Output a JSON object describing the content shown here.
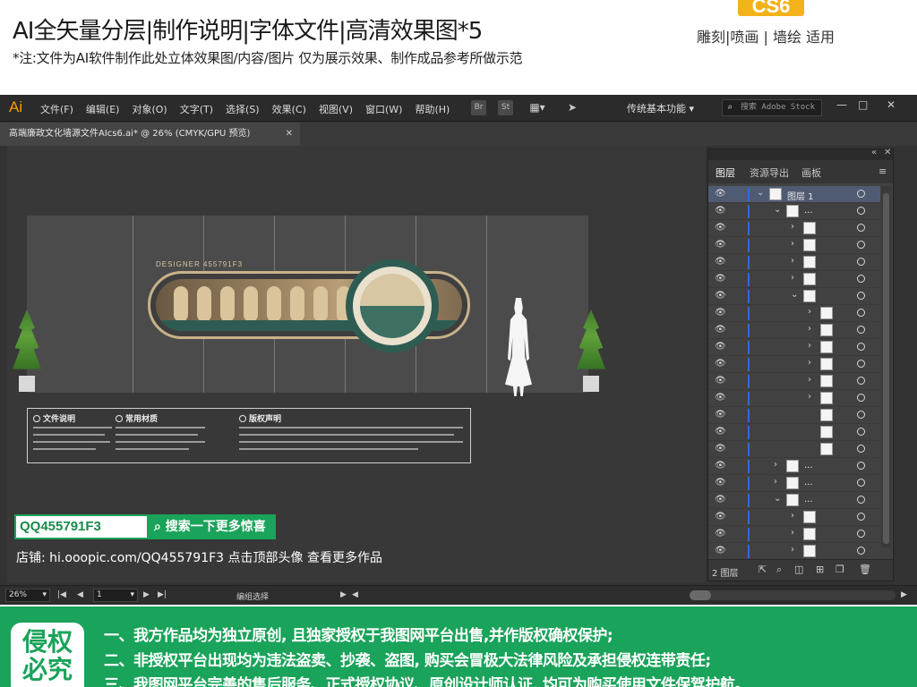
{
  "promo": {
    "title": "AI全矢量分层|制作说明|字体文件|高清效果图*5",
    "note": "*注:文件为AI软件制作此处立体效果图/内容/图片 仅为展示效果、制作成品参考所做示范",
    "version_badge": "CS6",
    "usage": "雕刻|喷画 | 墙绘 适用"
  },
  "app": {
    "logo": "Ai",
    "menu": [
      "文件(F)",
      "编辑(E)",
      "对象(O)",
      "文字(T)",
      "选择(S)",
      "效果(C)",
      "视图(V)",
      "窗口(W)",
      "帮助(H)"
    ],
    "toolbar_buttons": [
      "Br",
      "St"
    ],
    "workspace": "传统基本功能",
    "stock_placeholder": "搜索 Adobe Stock",
    "document_tab": "高端廉政文化墙源文件AIcs6.ai* @ 26% (CMYK/GPU 预览)",
    "window_controls": [
      "—",
      "□",
      "✕"
    ]
  },
  "artwork": {
    "sign_title": "DESIGNER 455791F3",
    "desc_columns": [
      "文件说明",
      "常用材质",
      "版权声明"
    ]
  },
  "overlay": {
    "qq": "QQ455791F3",
    "search_button": "搜索一下更多惊喜",
    "shop_line": "店铺: hi.ooopic.com/QQ455791F3  点击顶部头像 查看更多作品"
  },
  "statusbar": {
    "zoom": "26%",
    "artboard": "1",
    "mode": "编组选择"
  },
  "layers_panel": {
    "tabs": [
      "图层",
      "资源导出",
      "画板"
    ],
    "top_layer": "图层 1",
    "ellipsis": "...",
    "count_label": "2 图层"
  },
  "banner": {
    "badge_lines": [
      "侵权",
      "必究"
    ],
    "lines": [
      "一、我方作品均为独立原创, 且独家授权于我图网平台出售,并作版权确权保护;",
      "二、非授权平台出现均为违法盗卖、抄袭、盗图, 购买会冒极大法律风险及承担侵权连带责任;",
      "三、我图网平台完善的售后服务、正式授权协议、原创设计师认证, 均可为购买使用文件保驾护航。"
    ]
  },
  "colors": {
    "accent_green": "#1aa35a",
    "ai_orange": "#ff9a00",
    "cs_badge": "#f3b21a",
    "layer_bar": "#2f6bd9"
  }
}
